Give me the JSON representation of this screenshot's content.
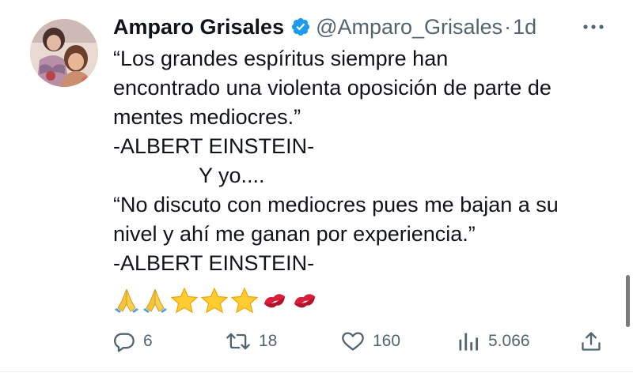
{
  "tweet": {
    "author": {
      "name": "Amparo Grisales",
      "handle": "@Amparo_Grisales",
      "verified": true,
      "avatar_icon": "profile-photo"
    },
    "separator": "·",
    "time": "1d",
    "more_icon": "more-horizontal-icon",
    "lines": [
      "“Los grandes espíritus siempre han",
      "encontrado una violenta oposición de parte de",
      "mentes mediocres.”",
      "-ALBERT EINSTEIN-",
      "Y yo....",
      "“No discuto con mediocres pues me bajan a su",
      "nivel y ahí me ganan por experiencia.”",
      "-ALBERT EINSTEIN-"
    ],
    "emojis": [
      "folded-hands",
      "folded-hands",
      "star",
      "star",
      "star",
      "kiss-mark",
      "kiss-mark"
    ],
    "actions": {
      "replies": "6",
      "retweets": "18",
      "likes": "160",
      "views": "5.066"
    },
    "colors": {
      "text": "#0f1419",
      "secondary": "#536471",
      "verified": "#1d9bf0",
      "divider": "#eff3f4"
    }
  }
}
